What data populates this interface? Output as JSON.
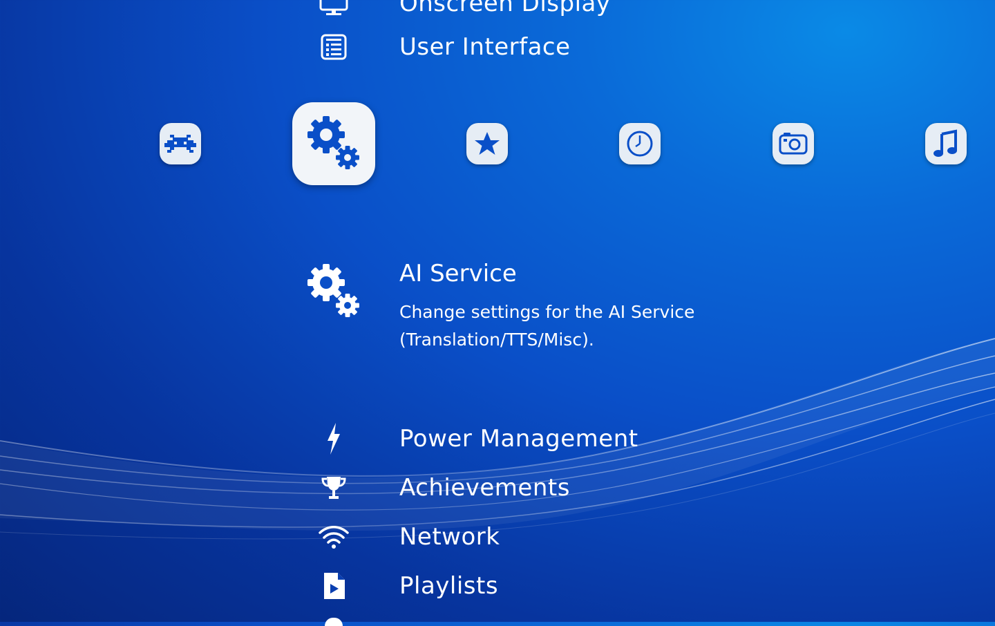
{
  "menu": {
    "top_items": [
      {
        "label": "Onscreen Display",
        "icon": "monitor-icon"
      },
      {
        "label": "User Interface",
        "icon": "list-icon"
      }
    ],
    "selected": {
      "label": "AI Service",
      "description_line1": "Change settings for the AI Service",
      "description_line2": "(Translation/TTS/Misc).",
      "icon": "gears-icon"
    },
    "bottom_items": [
      {
        "label": "Power Management",
        "icon": "lightning-icon"
      },
      {
        "label": "Achievements",
        "icon": "trophy-icon"
      },
      {
        "label": "Network",
        "icon": "wifi-icon"
      },
      {
        "label": "Playlists",
        "icon": "playlist-file-icon"
      }
    ]
  },
  "tabs": [
    {
      "name": "main-menu",
      "icon": "retroarch-invader-icon",
      "active": false
    },
    {
      "name": "settings",
      "icon": "settings-gears-icon",
      "active": true
    },
    {
      "name": "favorites",
      "icon": "star-icon",
      "active": false
    },
    {
      "name": "history",
      "icon": "clock-icon",
      "active": false
    },
    {
      "name": "images",
      "icon": "camera-icon",
      "active": false
    },
    {
      "name": "music",
      "icon": "music-note-icon",
      "active": false
    }
  ],
  "colors": {
    "tab_icon": "#0a4fc8",
    "background_top": "#0a8ae6",
    "background_bottom": "#05267c"
  }
}
